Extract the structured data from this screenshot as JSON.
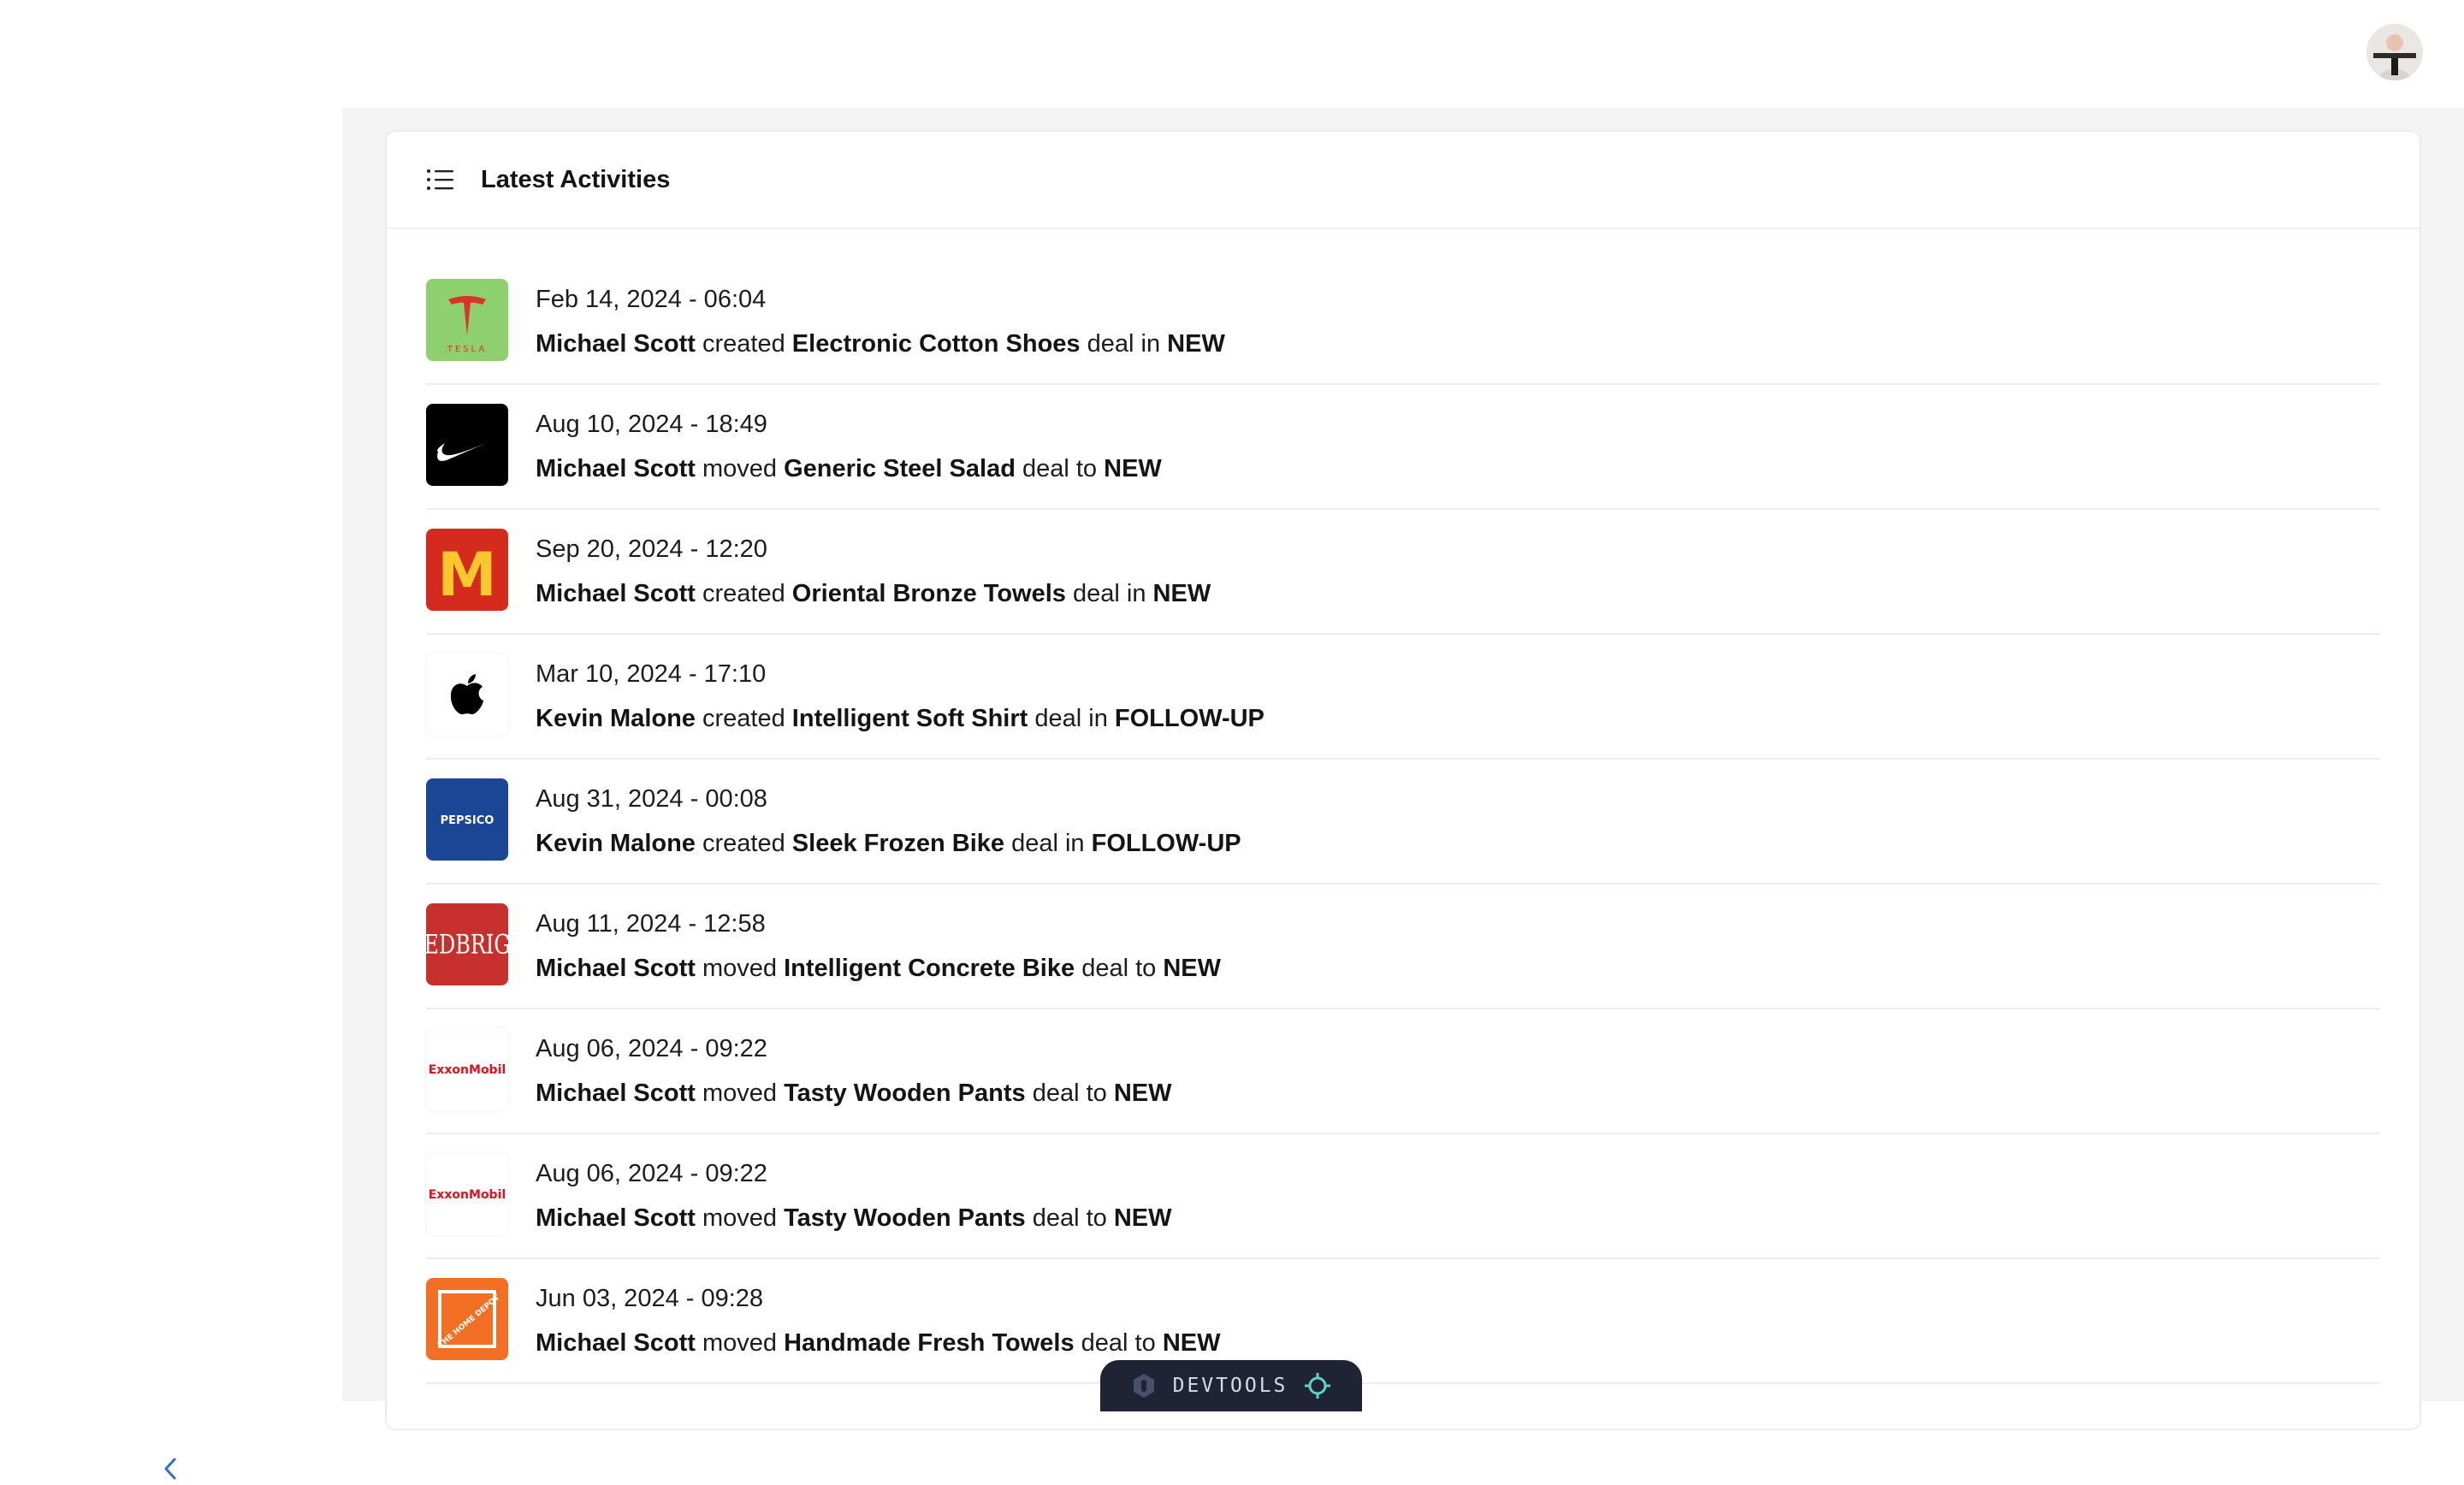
{
  "header": {
    "avatar_alt": "User avatar"
  },
  "card": {
    "title": "Latest Activities"
  },
  "activities": [
    {
      "date": "Feb 14, 2024 - 06:04",
      "user": "Michael Scott",
      "action": "created",
      "deal": "Electronic Cotton Shoes",
      "connector": "deal in",
      "stage": "NEW",
      "company_icon": "tesla-logo",
      "logo_text": "TESLA"
    },
    {
      "date": "Aug 10, 2024 - 18:49",
      "user": "Michael Scott",
      "action": "moved",
      "deal": "Generic Steel Salad",
      "connector": "deal to",
      "stage": "NEW",
      "company_icon": "nike-logo",
      "logo_text": ""
    },
    {
      "date": "Sep 20, 2024 - 12:20",
      "user": "Michael Scott",
      "action": "created",
      "deal": "Oriental Bronze Towels",
      "connector": "deal in",
      "stage": "NEW",
      "company_icon": "mcdonalds-logo",
      "logo_text": "M"
    },
    {
      "date": "Mar 10, 2024 - 17:10",
      "user": "Kevin Malone",
      "action": "created",
      "deal": "Intelligent Soft Shirt",
      "connector": "deal in",
      "stage": "FOLLOW-UP",
      "company_icon": "apple-logo",
      "logo_text": ""
    },
    {
      "date": "Aug 31, 2024 - 00:08",
      "user": "Kevin Malone",
      "action": "created",
      "deal": "Sleek Frozen Bike",
      "connector": "deal in",
      "stage": "FOLLOW-UP",
      "company_icon": "pepsico-logo",
      "logo_text": "PEPSICO"
    },
    {
      "date": "Aug 11, 2024 - 12:58",
      "user": "Michael Scott",
      "action": "moved",
      "deal": "Intelligent Concrete Bike",
      "connector": "deal to",
      "stage": "NEW",
      "company_icon": "edbrig-logo",
      "logo_text": "EDBRIG"
    },
    {
      "date": "Aug 06, 2024 - 09:22",
      "user": "Michael Scott",
      "action": "moved",
      "deal": "Tasty Wooden Pants",
      "connector": "deal to",
      "stage": "NEW",
      "company_icon": "exxonmobil-logo",
      "logo_text": "ExxonMobil"
    },
    {
      "date": "Aug 06, 2024 - 09:22",
      "user": "Michael Scott",
      "action": "moved",
      "deal": "Tasty Wooden Pants",
      "connector": "deal to",
      "stage": "NEW",
      "company_icon": "exxonmobil-logo",
      "logo_text": "ExxonMobil"
    },
    {
      "date": "Jun 03, 2024 - 09:28",
      "user": "Michael Scott",
      "action": "moved",
      "deal": "Handmade Fresh Towels",
      "connector": "deal to",
      "stage": "NEW",
      "company_icon": "home-depot-logo",
      "logo_text": "THE HOME DEPOT"
    }
  ],
  "sidebar": {
    "collapse_icon": "chevron-left-icon"
  },
  "devtools": {
    "label": "DEVTOOLS"
  },
  "colors": {
    "accent": "#2f6fd6",
    "devtools_bg": "#1f2333",
    "devtools_crosshair": "#5bd3c8"
  }
}
